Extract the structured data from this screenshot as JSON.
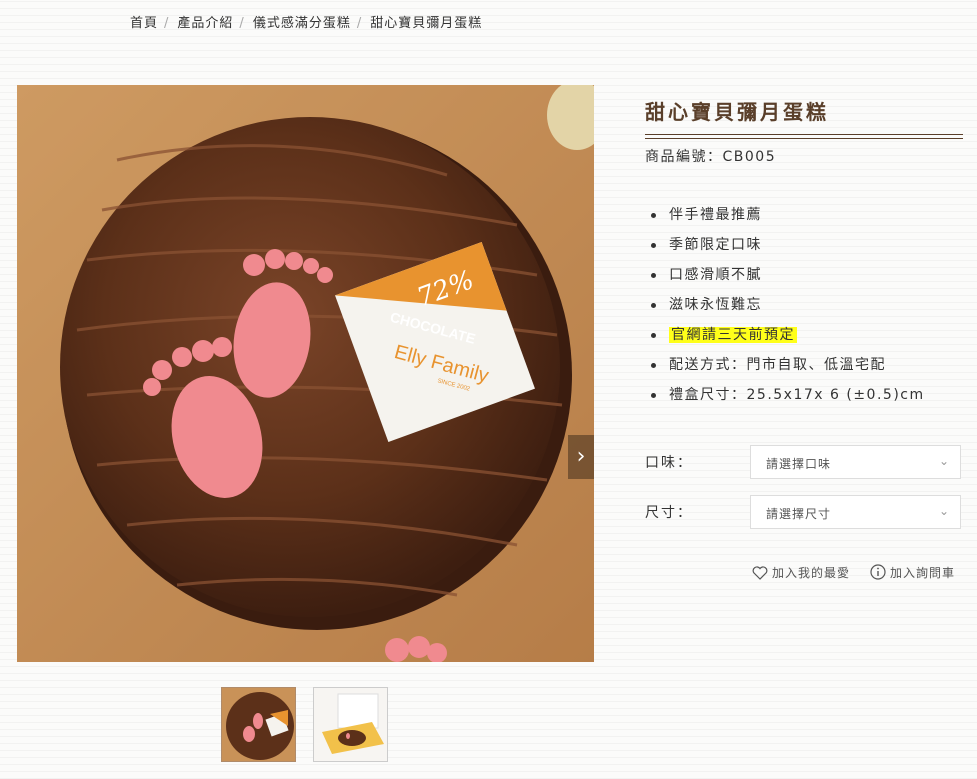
{
  "breadcrumb": [
    "首頁",
    "產品介紹",
    "儀式感滿分蛋糕",
    "甜心寶貝彌月蛋糕"
  ],
  "breadcrumb_sep": "/",
  "product": {
    "title": "甜心寶貝彌月蛋糕",
    "code_label": "商品編號：",
    "code": "CB005",
    "features": [
      "伴手禮最推薦",
      "季節限定口味",
      "口感滑順不膩",
      "滋味永恆難忘",
      "官網請三天前預定",
      "配送方式：門市自取、低溫宅配",
      "禮盒尺寸：25.5x17x 6 (±0.5)cm"
    ],
    "highlight_color": "#ffff1a"
  },
  "hero_badge": {
    "percent": "72%",
    "word": "CHOCOLATE",
    "brand": "Elly Family",
    "since": "SINCE 2002"
  },
  "hero_next_icon": "chevron-right-icon",
  "options": {
    "flavor_label": "口味：",
    "flavor_placeholder": "請選擇口味",
    "size_label": "尺寸：",
    "size_placeholder": "請選擇尺寸"
  },
  "actions": {
    "favorite": "加入我的最愛",
    "inquiry": "加入詢問車"
  },
  "colors": {
    "title": "#5a3f2a",
    "accent": "#e8932f"
  }
}
